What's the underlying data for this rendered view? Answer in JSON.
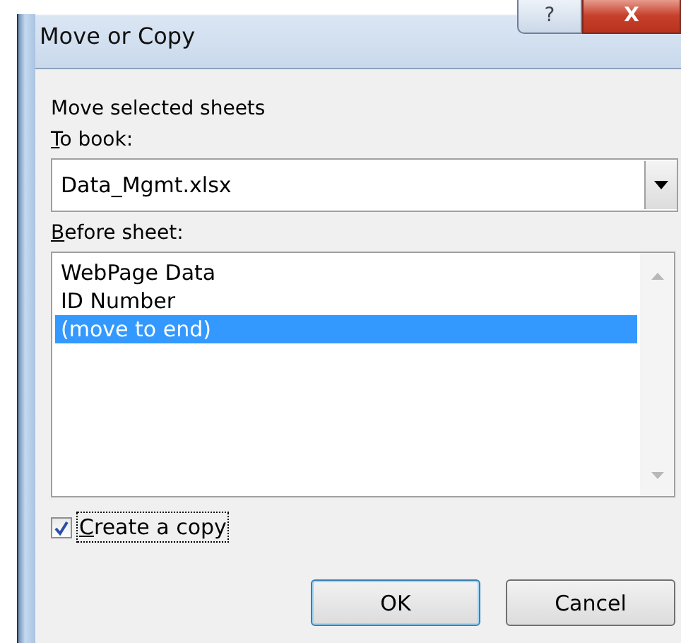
{
  "window": {
    "title": "Move or Copy",
    "help_button": "?",
    "close_button": "X"
  },
  "heading": "Move selected sheets",
  "to_book": {
    "label": "To book:",
    "value": "Data_Mgmt.xlsx"
  },
  "before_sheet": {
    "label": "Before sheet:",
    "items": [
      {
        "label": "WebPage Data",
        "selected": false
      },
      {
        "label": "ID Number",
        "selected": false
      },
      {
        "label": "(move to end)",
        "selected": true
      }
    ]
  },
  "create_copy": {
    "label": "Create a copy",
    "checked": true
  },
  "buttons": [
    {
      "label": "OK",
      "kind": "default"
    },
    {
      "label": "Cancel",
      "kind": "normal"
    }
  ]
}
